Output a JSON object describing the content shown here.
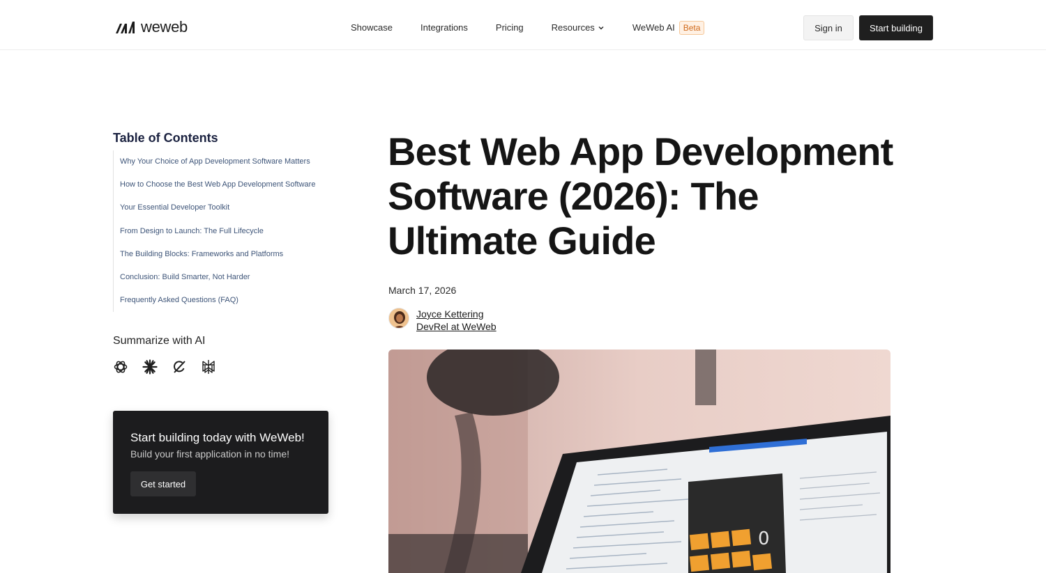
{
  "header": {
    "logo_text": "weweb",
    "nav": [
      {
        "label": "Showcase"
      },
      {
        "label": "Integrations"
      },
      {
        "label": "Pricing"
      },
      {
        "label": "Resources"
      },
      {
        "label": "WeWeb AI"
      }
    ],
    "beta_badge": "Beta",
    "sign_in": "Sign in",
    "start_building": "Start building"
  },
  "sidebar": {
    "toc_title": "Table of Contents",
    "toc_items": [
      "Why Your Choice of App Development Software Matters",
      "How to Choose the Best Web App Development Software",
      "Your Essential Developer Toolkit",
      "From Design to Launch: The Full Lifecycle",
      "The Building Blocks: Frameworks and Platforms",
      "Conclusion: Build Smarter, Not Harder",
      "Frequently Asked Questions (FAQ)"
    ],
    "summarize_title": "Summarize with AI",
    "ai_icons": [
      "chatgpt-icon",
      "claude-icon",
      "grok-icon",
      "perplexity-icon"
    ],
    "promo": {
      "title": "Start building today with WeWeb!",
      "subtitle": "Build your first application in no time!",
      "button": "Get started"
    }
  },
  "article": {
    "title": "Best Web App Development Software (2026): The Ultimate Guide",
    "date": "March 17, 2026",
    "author_name": "Joyce Kettering",
    "author_role": "DevRel at WeWeb"
  },
  "colors": {
    "accent_dark": "#1f1f1f",
    "toc_link": "#3d5478",
    "beta_text": "#d0691a",
    "beta_bg": "#fff1e4"
  }
}
